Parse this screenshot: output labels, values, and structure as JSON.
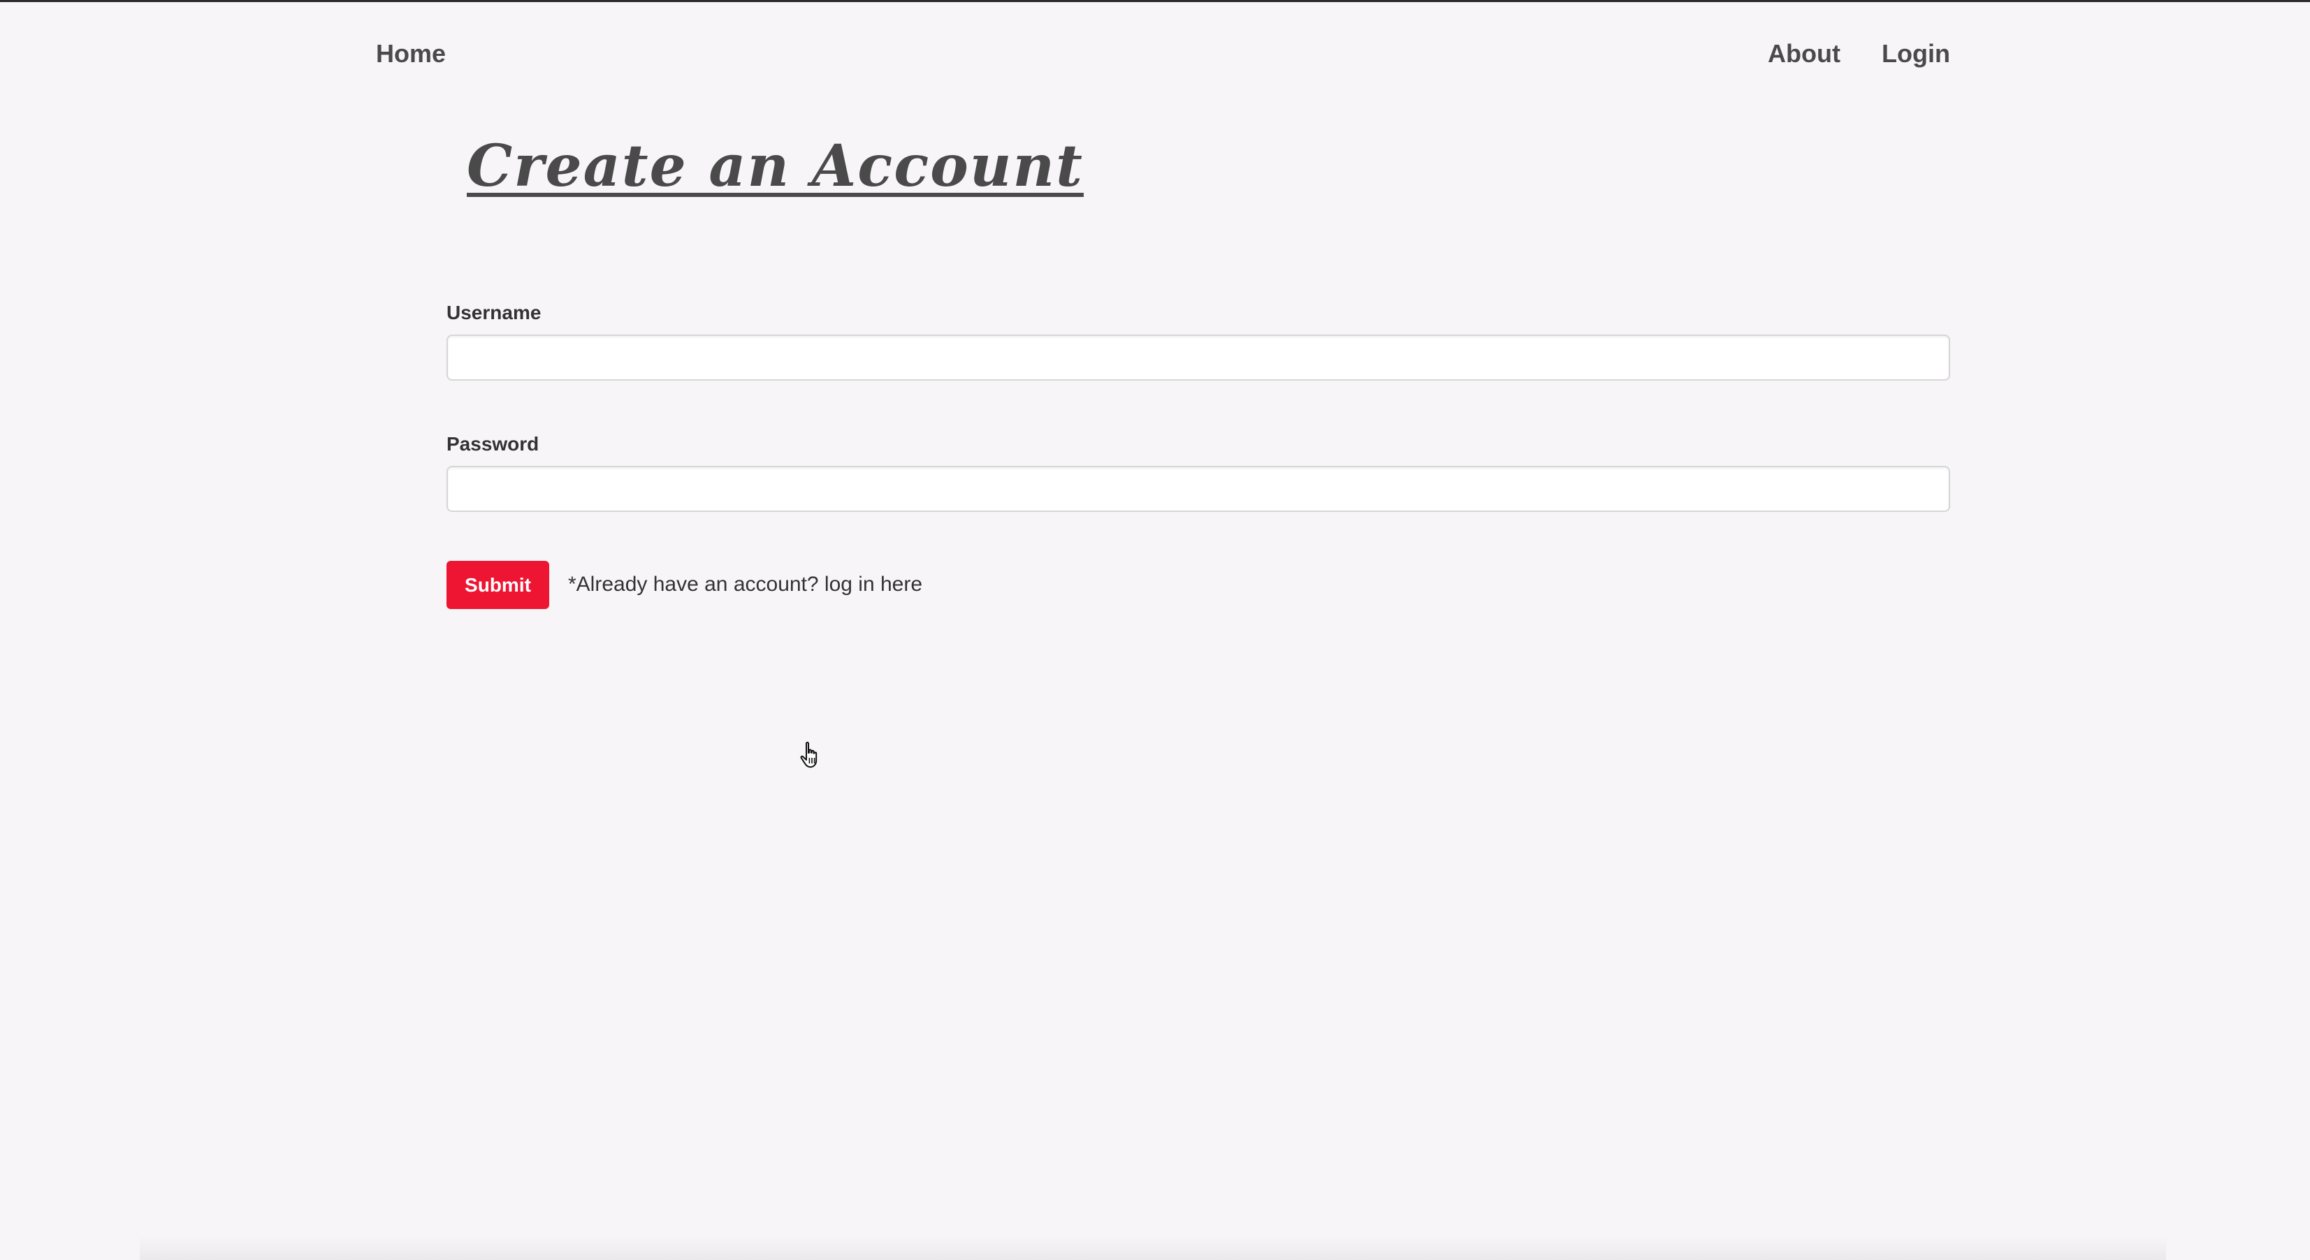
{
  "nav": {
    "home_label": "Home",
    "about_label": "About",
    "login_label": "Login"
  },
  "page": {
    "title": "Create an Account"
  },
  "form": {
    "username_label": "Username",
    "username_value": "",
    "password_label": "Password",
    "password_value": "",
    "submit_label": "Submit",
    "login_hint_prefix": "*Already have an account? ",
    "login_hint_link": "log in here"
  },
  "colors": {
    "background": "#f7f5f8",
    "accent": "#ee1533",
    "text": "#333333",
    "nav_text": "#4a4a4a"
  },
  "icons": {
    "cursor": "hand-pointer-icon"
  }
}
